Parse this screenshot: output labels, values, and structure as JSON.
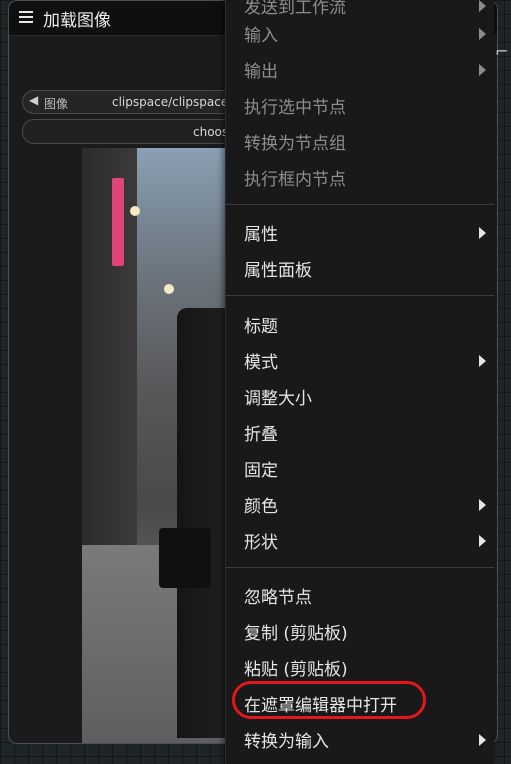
{
  "node": {
    "title": "加载图像",
    "image_widget_label": "图像",
    "image_widget_value": "clipspace/clipspace",
    "choose_button_label": "choos"
  },
  "menu": {
    "items": [
      {
        "label": "发送到工作流",
        "disabled": true,
        "submenu": true
      },
      {
        "label": "输入",
        "disabled": true,
        "submenu": true
      },
      {
        "label": "输出",
        "disabled": true,
        "submenu": true
      },
      {
        "label": "执行选中节点",
        "disabled": true,
        "submenu": false
      },
      {
        "label": "转换为节点组",
        "disabled": true,
        "submenu": false
      },
      {
        "label": "执行框内节点",
        "disabled": true,
        "submenu": false
      },
      {
        "label": "属性",
        "disabled": false,
        "submenu": true
      },
      {
        "label": "属性面板",
        "disabled": false,
        "submenu": false
      },
      {
        "label": "标题",
        "disabled": false,
        "submenu": false
      },
      {
        "label": "模式",
        "disabled": false,
        "submenu": true
      },
      {
        "label": "调整大小",
        "disabled": false,
        "submenu": false
      },
      {
        "label": "折叠",
        "disabled": false,
        "submenu": false
      },
      {
        "label": "固定",
        "disabled": false,
        "submenu": false
      },
      {
        "label": "颜色",
        "disabled": false,
        "submenu": true
      },
      {
        "label": "形状",
        "disabled": false,
        "submenu": true
      },
      {
        "label": "忽略节点",
        "disabled": false,
        "submenu": false
      },
      {
        "label": "复制 (剪贴板)",
        "disabled": false,
        "submenu": false
      },
      {
        "label": "粘贴 (剪贴板)",
        "disabled": false,
        "submenu": false
      },
      {
        "label": "在遮罩编辑器中打开",
        "disabled": false,
        "submenu": false
      },
      {
        "label": "转换为输入",
        "disabled": false,
        "submenu": true
      }
    ]
  },
  "colors": {
    "highlight_ring": "#e3171b",
    "menu_background": "#19191a",
    "enabled_text": "#e6e6e6",
    "disabled_text": "#8d8d8d"
  }
}
